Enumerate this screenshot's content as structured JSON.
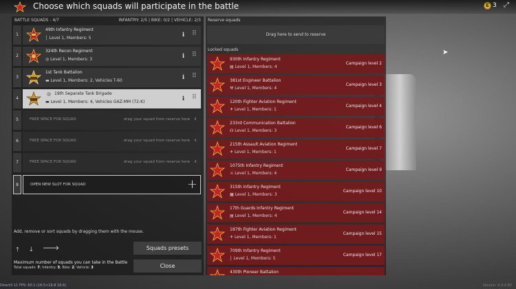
{
  "header": {
    "title": "Choose which squads will participate in the battle",
    "currency": "3"
  },
  "battle": {
    "header_left": "BATTLE SQUADS : 4/7",
    "header_right": "INFANTRY: 2/5 | BIKE: 0/2 | VEHICLE: 2/3",
    "squads": [
      {
        "num": "1",
        "name": "49th Infantry Regiment",
        "info": "Level 1, Members: 5"
      },
      {
        "num": "2",
        "name": "324th Recon Regiment",
        "info": "Level 1, Members: 3"
      },
      {
        "num": "3",
        "name": "1st Tank Battalion",
        "info": "Level 1, Members: 2, Vehicles T-60"
      },
      {
        "num": "4",
        "name": "19th Separate Tank Brigade",
        "info": "Level 1, Members: 4, Vehicles GAZ-MM (72-K)"
      }
    ],
    "empty_slots": [
      {
        "num": "5",
        "label": "FREE SPACE FOR SQUAD",
        "hint": "drag your squad from reserve here"
      },
      {
        "num": "6",
        "label": "FREE SPACE FOR SQUAD",
        "hint": "drag your squad from reserve here"
      },
      {
        "num": "7",
        "label": "FREE SPACE FOR SQUAD",
        "hint": "drag your squad from reserve here"
      }
    ],
    "open_slot": {
      "num": "8",
      "label": "OPEN NEW SLOT FOR SQUAD"
    },
    "hint": "Add, remove or sort squads by dragging them with the mouse.",
    "max_text": "Maximum number of squads you can take in the Battle",
    "max_sub": {
      "total_label": "Total squads:",
      "total": "7",
      "infantry_label": "Infantry:",
      "infantry": "5",
      "bike_label": "Bike:",
      "bike": "2",
      "vehicle_label": "Vehicle:",
      "vehicle": "3"
    },
    "presets_label": "Squads presets",
    "close_label": "Close"
  },
  "reserve": {
    "header": "Reserve squads",
    "drop_text": "Drag here to send to reserve",
    "locked_header": "Locked squads",
    "locked": [
      {
        "name": "930th Infantry Regiment",
        "info": "Level 1, Members: 4",
        "campaign": "Campaign level 2"
      },
      {
        "name": "381st Engineer Battalion",
        "info": "Level 1, Members: 4",
        "campaign": "Campaign level 3"
      },
      {
        "name": "120th Fighter Aviation Regiment",
        "info": "Level 1, Members: 1",
        "campaign": "Campaign level 4"
      },
      {
        "name": "233rd Communication Battalion",
        "info": "Level 1, Members: 3",
        "campaign": "Campaign level 6"
      },
      {
        "name": "215th Assault Aviation Regiment",
        "info": "Level 1, Members: 1",
        "campaign": "Campaign level 7"
      },
      {
        "name": "1075th Infantry Regiment",
        "info": "Level 1, Members: 4",
        "campaign": "Campaign level 9"
      },
      {
        "name": "315th Infantry Regiment",
        "info": "Level 1, Members: 3",
        "campaign": "Campaign level 10"
      },
      {
        "name": "17th Guards Infantry Regiment",
        "info": "Level 1, Members: 4",
        "campaign": "Campaign level 14"
      },
      {
        "name": "187th Fighter Aviation Regiment",
        "info": "Level 1, Members: 1",
        "campaign": "Campaign level 15"
      },
      {
        "name": "709th Infantry Regiment",
        "info": "Level 1, Members: 5",
        "campaign": "Campaign level 17"
      },
      {
        "name": "430th Pioneer Battalion",
        "info": "",
        "campaign": ""
      }
    ]
  },
  "status": {
    "fps": "DirectX 11 FPS: 60.1 (16.5<16.8 16.6)",
    "version": "Version: 0.4.4.83"
  },
  "colors": {
    "locked_bg": "#781a1c",
    "accent": "#d9b13a",
    "selected_bg": "#cfcfcf"
  }
}
